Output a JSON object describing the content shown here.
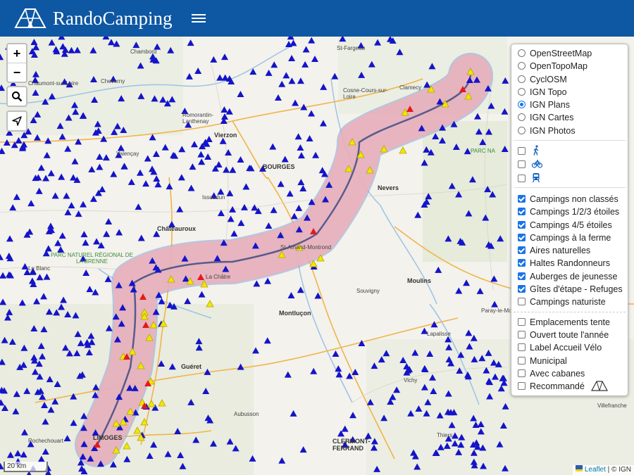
{
  "header": {
    "app_name": "RandoCamping"
  },
  "map": {
    "labels": {
      "bourges": "BOURGES",
      "nevers": "Nevers",
      "vierzon": "Vierzon",
      "chateauroux": "Châteauroux",
      "moulins": "Moulins",
      "montlucon": "Montluçon",
      "gueret": "Guéret",
      "limoges": "LIMOGES",
      "clermont": "CLERMONT-\nFERRAND",
      "aubusson": "Aubusson",
      "saint_amand": "St-Amand-Montrond",
      "cosne": "Cosne-Cours-sur-\nLoire",
      "romorantin": "Romorantin-\nLanthenay",
      "issoudun": "Issoudun",
      "clamecy": "Clamecy",
      "vichy": "Vichy",
      "souvigny": "Souvigny",
      "chambord": "Chambord",
      "cheverny": "Cheverny",
      "chaumont": "Chaumont-sur-Loire",
      "valencay": "Valençay",
      "le_blanc": "Le Blanc",
      "rochechouart": "Rochechouart",
      "thiers": "Thiers",
      "saint_fargeau": "St-Fargeau",
      "paray": "Paray-le-Monial",
      "lapalisse": "Lapalisse",
      "villefranche": "Villefranche",
      "park_brenne": "PARC NATUREL RÉGIONAL DE\nLA BRENNE",
      "park_morvan": "PARC NA",
      "chatre": "La Châtre"
    },
    "base_layers": [
      {
        "label": "OpenStreetMap",
        "selected": false
      },
      {
        "label": "OpenTopoMap",
        "selected": false
      },
      {
        "label": "CyclOSM",
        "selected": false
      },
      {
        "label": "IGN Topo",
        "selected": false
      },
      {
        "label": "IGN Plans",
        "selected": true
      },
      {
        "label": "IGN Cartes",
        "selected": false
      },
      {
        "label": "IGN Photos",
        "selected": false
      }
    ],
    "mode_filters": [
      {
        "icon": "hiker-icon",
        "checked": false
      },
      {
        "icon": "bicycle-icon",
        "checked": false
      },
      {
        "icon": "train-icon",
        "checked": false
      }
    ],
    "categories": [
      {
        "label": "Campings non classés",
        "checked": true
      },
      {
        "label": "Campings 1/2/3 étoiles",
        "checked": true
      },
      {
        "label": "Campings 4/5 étoiles",
        "checked": true
      },
      {
        "label": "Campings à la ferme",
        "checked": true
      },
      {
        "label": "Aires naturelles",
        "checked": true
      },
      {
        "label": "Haltes Randonneurs",
        "checked": true
      },
      {
        "label": "Auberges de jeunesse",
        "checked": true
      },
      {
        "label": "Gîtes d'étape - Refuges",
        "checked": true
      },
      {
        "label": "Campings naturiste",
        "checked": false
      }
    ],
    "options": [
      {
        "label": "Emplacements tente",
        "checked": false
      },
      {
        "label": "Ouvert toute l'année",
        "checked": false
      },
      {
        "label": "Label Accueil Vélo",
        "checked": false
      },
      {
        "label": "Municipal",
        "checked": false
      },
      {
        "label": "Avec cabanes",
        "checked": false
      },
      {
        "label": "Recommandé",
        "checked": false
      }
    ],
    "scale_label": "20 km",
    "attribution": {
      "leaflet": "Leaflet",
      "rest": " | © IGN"
    }
  },
  "colors": {
    "header": "#0e57a3",
    "campsite": "#1414c8",
    "route": "#5a5a8a",
    "buffer": "#f0a8b0"
  }
}
